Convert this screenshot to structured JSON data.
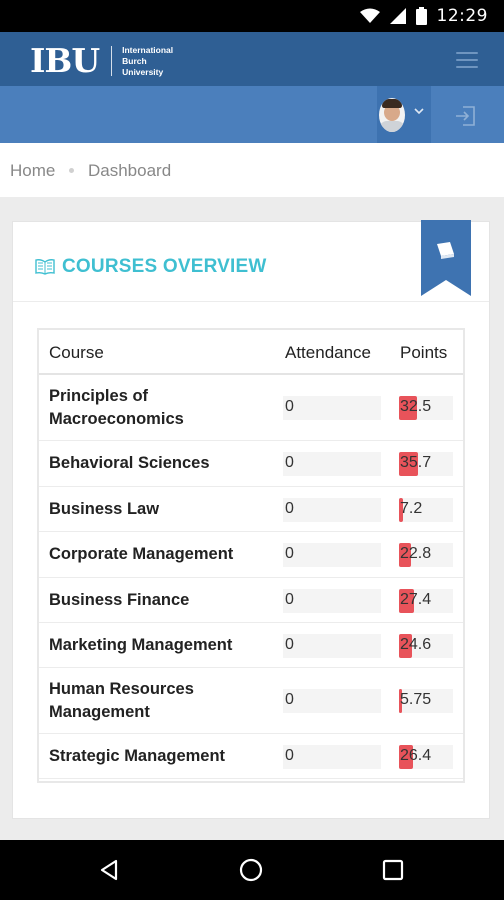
{
  "status_bar": {
    "time": "12:29"
  },
  "header": {
    "logo_mark": "IBU",
    "logo_lines": [
      "International",
      "Burch",
      "University"
    ]
  },
  "breadcrumb": {
    "home": "Home",
    "current": "Dashboard"
  },
  "card": {
    "title": "COURSES OVERVIEW"
  },
  "table": {
    "columns": [
      "Course",
      "Attendance",
      "Points"
    ],
    "rows": [
      {
        "course": "Principles of\nMacroeconomics",
        "attendance": "0",
        "points": "32.5",
        "points_value": 32.5
      },
      {
        "course": "Behavioral Sciences",
        "attendance": "0",
        "points": "35.7",
        "points_value": 35.7
      },
      {
        "course": "Business Law",
        "attendance": "0",
        "points": "7.2",
        "points_value": 7.2
      },
      {
        "course": "Corporate Management",
        "attendance": "0",
        "points": "22.8",
        "points_value": 22.8
      },
      {
        "course": "Business Finance",
        "attendance": "0",
        "points": "27.4",
        "points_value": 27.4
      },
      {
        "course": "Marketing Management",
        "attendance": "0",
        "points": "24.6",
        "points_value": 24.6
      },
      {
        "course": "Human Resources\nManagement",
        "attendance": "0",
        "points": "5.75",
        "points_value": 5.75
      },
      {
        "course": "Strategic Management",
        "attendance": "0",
        "points": "26.4",
        "points_value": 26.4
      }
    ]
  },
  "colors": {
    "topbar": "#2f5f94",
    "userbar": "#4b7fbc",
    "accent": "#3fbfd1",
    "points_bar": "#e8535a"
  },
  "icons": {
    "status": [
      "wifi-icon",
      "signal-icon",
      "battery-icon"
    ],
    "topbar": [
      "hamburger-icon"
    ],
    "userbar": [
      "avatar",
      "chevron-down-icon",
      "logout-icon"
    ],
    "card": [
      "book-icon",
      "bookmark-ribbon-icon"
    ],
    "navbar": [
      "back-icon",
      "home-icon",
      "recents-icon"
    ]
  }
}
